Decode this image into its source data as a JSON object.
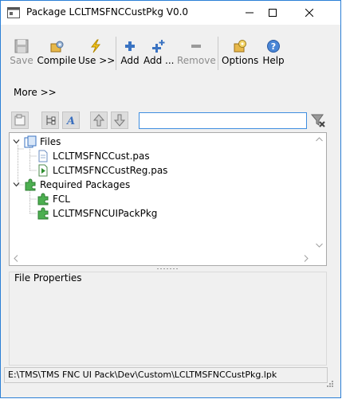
{
  "window": {
    "title": "Package LCLTMSFNCCustPkg V0.0",
    "controls": {
      "minimize": "minimize-icon",
      "maximize": "maximize-icon",
      "close": "close-icon"
    }
  },
  "toolbar": {
    "save": {
      "label": "Save",
      "icon": "floppy-disk-icon",
      "disabled": true
    },
    "compile": {
      "label": "Compile",
      "icon": "gear-box-icon"
    },
    "use": {
      "label": "Use >>",
      "icon": "lightning-icon"
    },
    "add": {
      "label": "Add",
      "icon": "plus-icon"
    },
    "add_more": {
      "label": "Add ...",
      "icon": "plus-multi-icon"
    },
    "remove": {
      "label": "Remove",
      "icon": "minus-icon",
      "disabled": true
    },
    "options": {
      "label": "Options",
      "icon": "options-icon"
    },
    "help": {
      "label": "Help",
      "icon": "help-icon"
    }
  },
  "more_label": "More >>",
  "filter": {
    "value": "",
    "placeholder": ""
  },
  "tree": {
    "files": {
      "label": "Files",
      "items": [
        {
          "label": "LCLTMSFNCCust.pas",
          "icon": "pas-file-icon"
        },
        {
          "label": "LCLTMSFNCCustReg.pas",
          "icon": "register-unit-icon"
        }
      ]
    },
    "required": {
      "label": "Required Packages",
      "items": [
        {
          "label": "FCL",
          "icon": "package-icon"
        },
        {
          "label": "LCLTMSFNCUIPackPkg",
          "icon": "package-icon"
        }
      ]
    }
  },
  "properties_title": "File Properties",
  "status_path": "E:\\TMS\\TMS FNC UI Pack\\Dev\\Custom\\LCLTMSFNCCustPkg.lpk",
  "colors": {
    "accent": "#2b7fd6",
    "package_green": "#3fa43f"
  }
}
